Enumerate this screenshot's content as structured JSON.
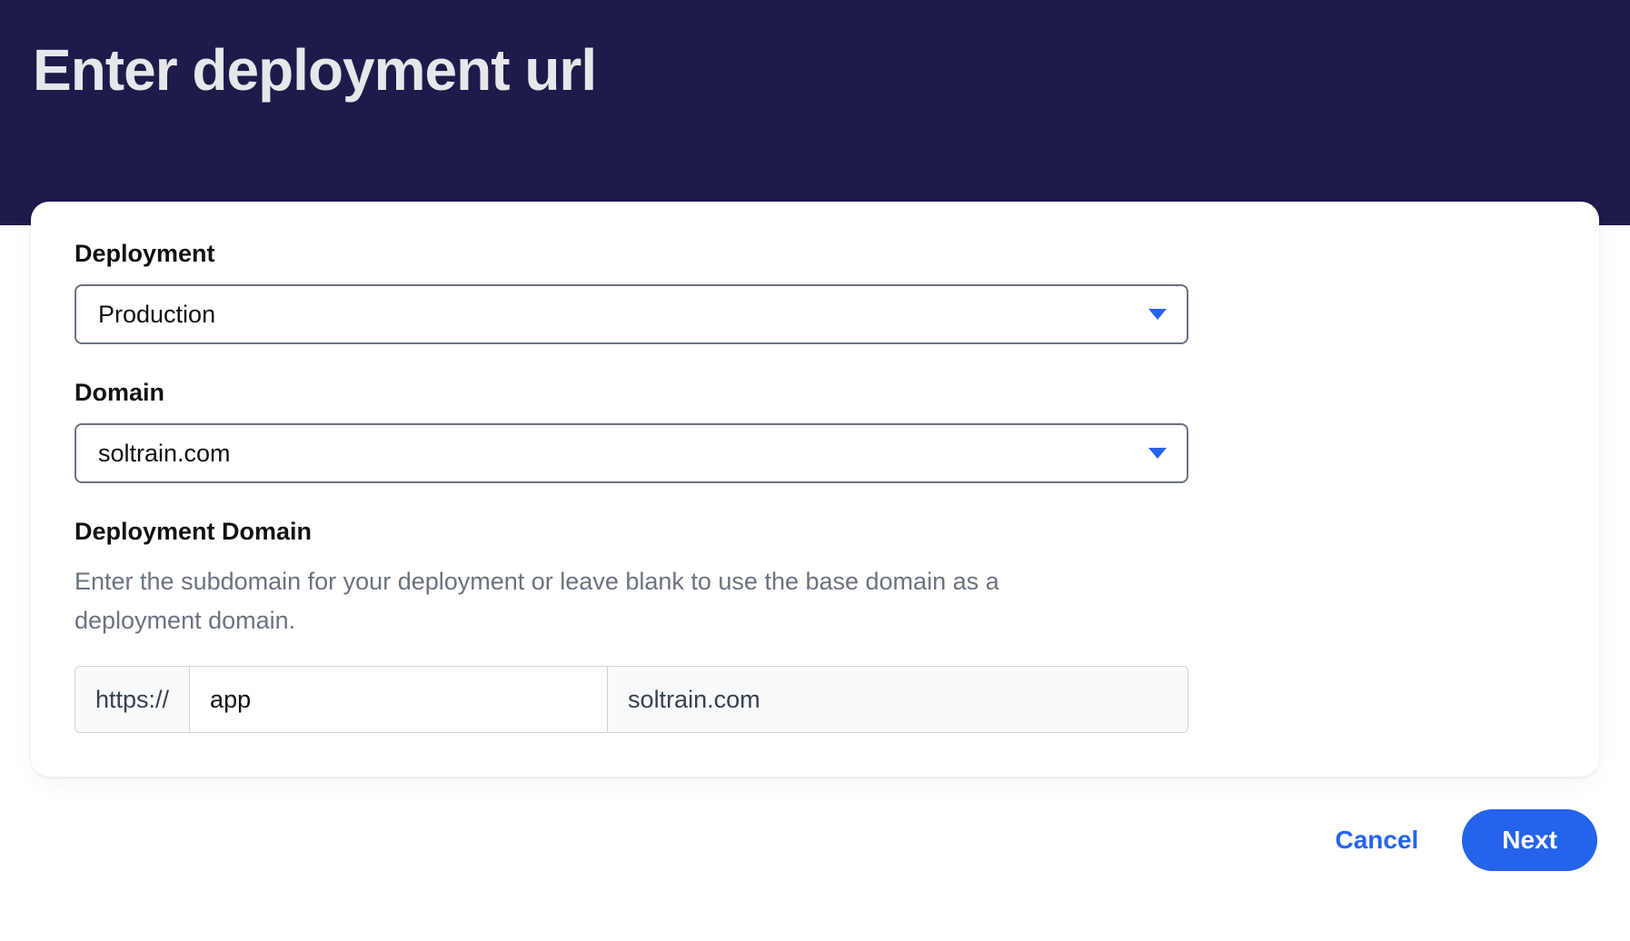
{
  "header": {
    "title": "Enter deployment url"
  },
  "form": {
    "deployment": {
      "label": "Deployment",
      "selected": "Production"
    },
    "domain": {
      "label": "Domain",
      "selected": "soltrain.com"
    },
    "deployment_domain": {
      "label": "Deployment Domain",
      "help_text": "Enter the subdomain for your deployment or leave blank to use the base domain as a deployment domain.",
      "prefix": "https://",
      "value": "app",
      "suffix": "soltrain.com"
    }
  },
  "footer": {
    "cancel_label": "Cancel",
    "next_label": "Next"
  }
}
